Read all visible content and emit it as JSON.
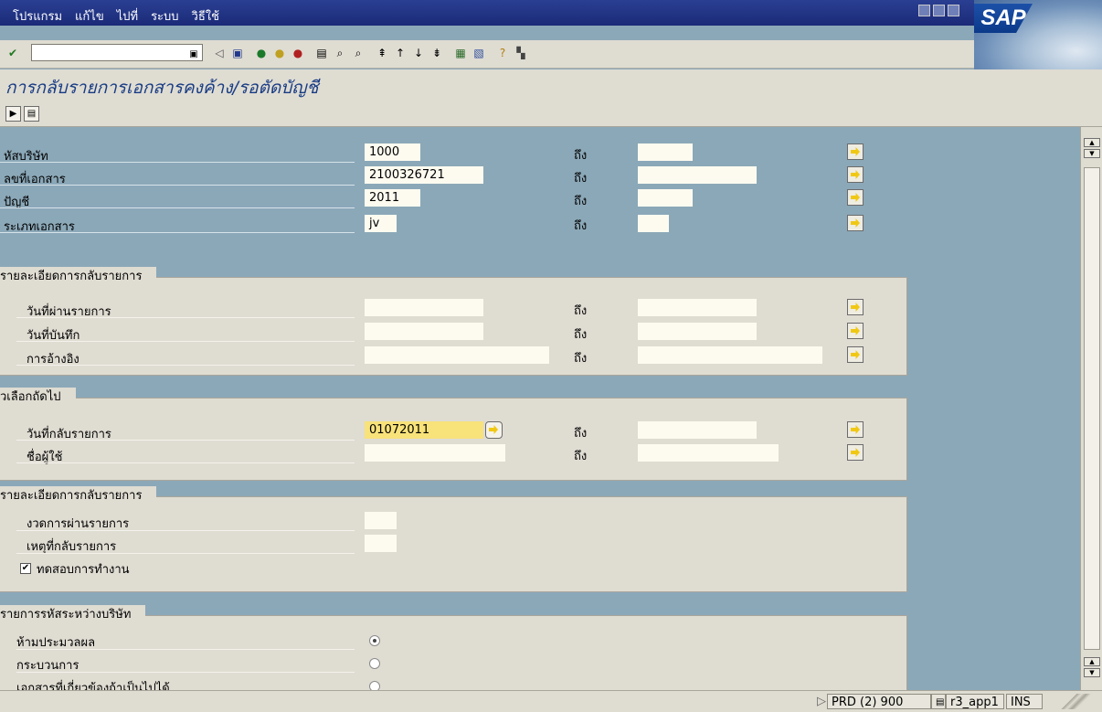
{
  "menu": {
    "items": [
      "โปรแกรม",
      "แก้ไข",
      "ไปที่",
      "ระบบ",
      "วิธีใช้"
    ]
  },
  "brand": {
    "logo_text": "SAP"
  },
  "toolbar": {
    "command_value": ""
  },
  "page": {
    "title": "การกลับรายการเอกสารคงค้าง/รอตัดบัญชี"
  },
  "selection": {
    "to_label": "ถึง",
    "rows": [
      {
        "label": "หัสบริษัท",
        "value": "1000"
      },
      {
        "label": "ลขที่เอกสาร",
        "value": "2100326721"
      },
      {
        "label": "ปัญชี",
        "value": "2011"
      },
      {
        "label": "ระเภทเอกสาร",
        "value": "jv"
      }
    ]
  },
  "group_reversal_details": {
    "title": "รายละเอียดการกลับรายการ",
    "rows": [
      {
        "label": "วันที่ผ่านรายการ",
        "value": ""
      },
      {
        "label": "วันที่บันทึก",
        "value": ""
      },
      {
        "label": "การอ้างอิง",
        "value": ""
      }
    ]
  },
  "group_next_selection": {
    "title": "ัวเลือกถัดไป",
    "rows": [
      {
        "label": "วันที่กลับรายการ",
        "value": "01072011"
      },
      {
        "label": "ชื่อผู้ใช้",
        "value": ""
      }
    ]
  },
  "group_reversal_details2": {
    "title": "รายละเอียดการกลับรายการ",
    "rows": [
      {
        "label": "งวดการผ่านรายการ",
        "value": ""
      },
      {
        "label": "เหตุที่กลับรายการ",
        "value": ""
      }
    ],
    "test_run_label": "ทดสอบการทำงาน",
    "test_run_checked": true
  },
  "group_intercompany": {
    "title": "รายการรหัสระหว่างบริษัท",
    "options": [
      {
        "label": "ห้ามประมวลผล",
        "selected": true
      },
      {
        "label": "กระบวนการ",
        "selected": false
      },
      {
        "label": "เอกสารที่เกี่ยวข้องถ้าเป็นไปได้",
        "selected": false
      }
    ]
  },
  "status": {
    "system": "PRD (2) 900",
    "server": "r3_app1",
    "mode": "INS"
  },
  "colors": {
    "menubar": "#1f2f80",
    "background": "#8ba8b8",
    "panel": "#dfdcd2",
    "highlight": "#f8e27a",
    "title": "#183c84"
  }
}
